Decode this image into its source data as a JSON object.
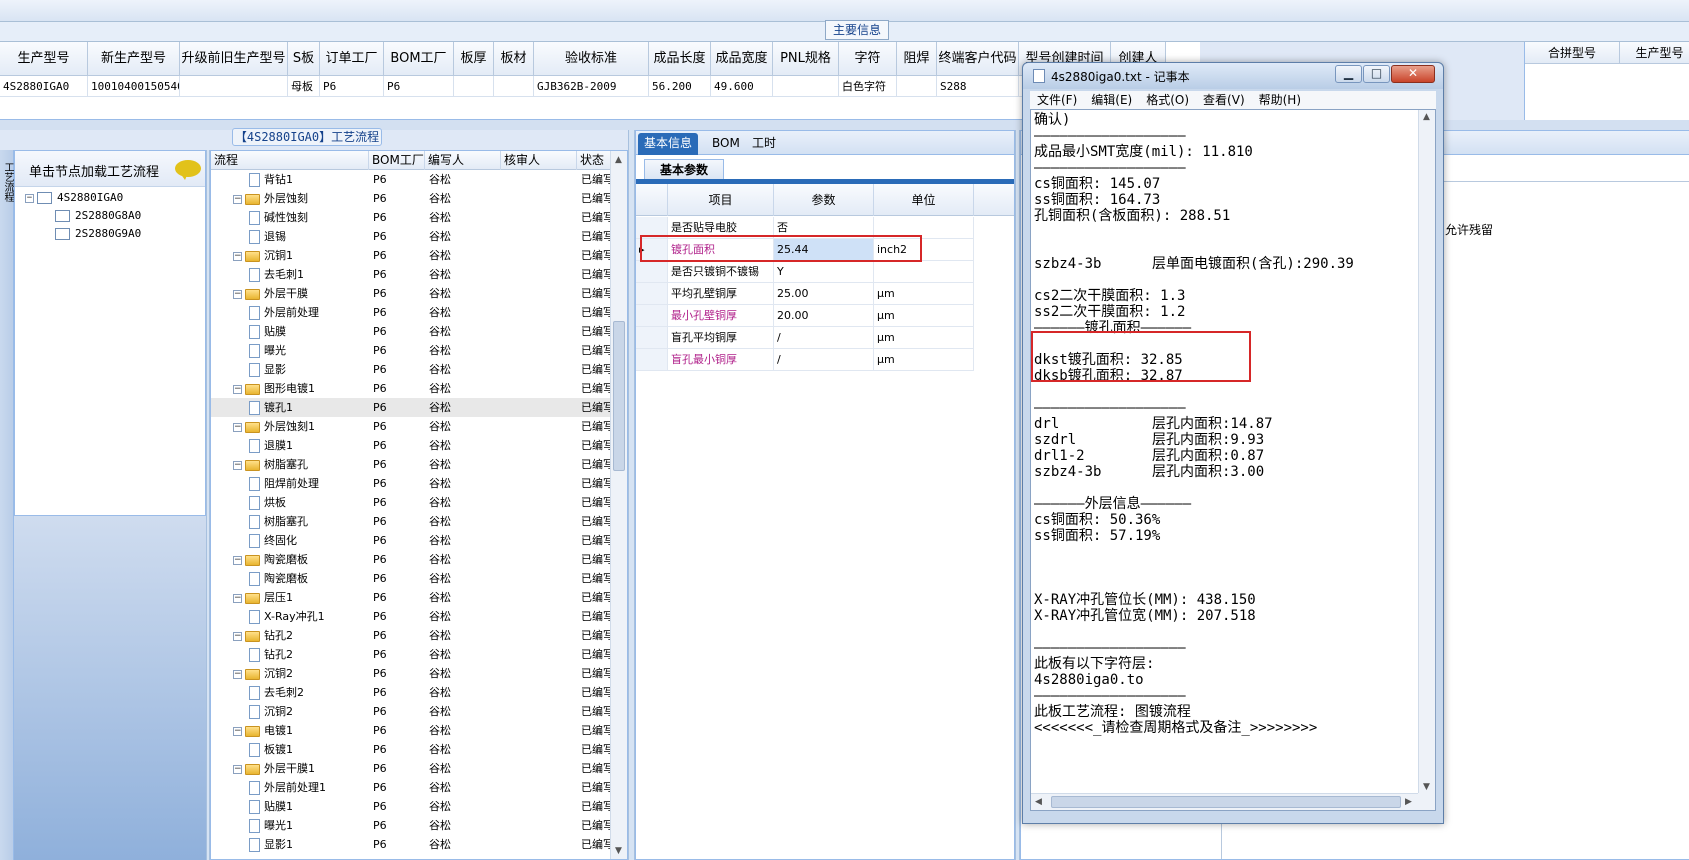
{
  "main_header": {
    "title": "主要信息",
    "columns": [
      "生产型号",
      "新生产型号",
      "升级前旧生产型号",
      "S板",
      "订单工厂",
      "BOM工厂",
      "板厚",
      "板材",
      "验收标准",
      "成品长度",
      "成品宽度",
      "PNL规格",
      "字符",
      "阻焊",
      "终端客户代码",
      "型号创建时间",
      "创建人"
    ],
    "row": [
      "4S2880IGA0",
      "10010400150540",
      "",
      "母板",
      "P6",
      "P6",
      "",
      "",
      "GJB362B-2009",
      "56.200",
      "49.600",
      "",
      "白色字符",
      "",
      "S288",
      "",
      ""
    ],
    "right_columns": [
      "合拼型号",
      "生产型号"
    ]
  },
  "left_panel": {
    "tab_label": "工艺流程",
    "header": "单击节点加载工艺流程",
    "tree": [
      "4S2880IGA0",
      "2S2880G8A0",
      "2S2880G9A0"
    ]
  },
  "flow_panel": {
    "title": "【4S2880IGA0】工艺流程",
    "columns": [
      "流程",
      "BOM工厂",
      "编写人",
      "核审人",
      "状态"
    ],
    "rows": [
      {
        "name": "背钻1",
        "level": 2,
        "folder": false,
        "bom": "P6",
        "author": "谷松",
        "reviewer": "",
        "status": "已编写"
      },
      {
        "name": "外层蚀刻",
        "level": 1,
        "folder": true,
        "bom": "P6",
        "author": "谷松",
        "reviewer": "",
        "status": "已编写"
      },
      {
        "name": "碱性蚀刻",
        "level": 2,
        "folder": false,
        "bom": "P6",
        "author": "谷松",
        "reviewer": "",
        "status": "已编写"
      },
      {
        "name": "退锡",
        "level": 2,
        "folder": false,
        "bom": "P6",
        "author": "谷松",
        "reviewer": "",
        "status": "已编写"
      },
      {
        "name": "沉铜1",
        "level": 1,
        "folder": true,
        "bom": "P6",
        "author": "谷松",
        "reviewer": "",
        "status": "已编写"
      },
      {
        "name": "去毛刺1",
        "level": 2,
        "folder": false,
        "bom": "P6",
        "author": "谷松",
        "reviewer": "",
        "status": "已编写"
      },
      {
        "name": "外层干膜",
        "level": 1,
        "folder": true,
        "bom": "P6",
        "author": "谷松",
        "reviewer": "",
        "status": "已编写"
      },
      {
        "name": "外层前处理",
        "level": 2,
        "folder": false,
        "bom": "P6",
        "author": "谷松",
        "reviewer": "",
        "status": "已编写"
      },
      {
        "name": "贴膜",
        "level": 2,
        "folder": false,
        "bom": "P6",
        "author": "谷松",
        "reviewer": "",
        "status": "已编写"
      },
      {
        "name": "曝光",
        "level": 2,
        "folder": false,
        "bom": "P6",
        "author": "谷松",
        "reviewer": "",
        "status": "已编写"
      },
      {
        "name": "显影",
        "level": 2,
        "folder": false,
        "bom": "P6",
        "author": "谷松",
        "reviewer": "",
        "status": "已编写"
      },
      {
        "name": "图形电镀1",
        "level": 1,
        "folder": true,
        "bom": "P6",
        "author": "谷松",
        "reviewer": "",
        "status": "已编写"
      },
      {
        "name": "镀孔1",
        "level": 2,
        "folder": false,
        "bom": "P6",
        "author": "谷松",
        "reviewer": "",
        "status": "已编写",
        "selected": true
      },
      {
        "name": "外层蚀刻1",
        "level": 1,
        "folder": true,
        "bom": "P6",
        "author": "谷松",
        "reviewer": "",
        "status": "已编写"
      },
      {
        "name": "退膜1",
        "level": 2,
        "folder": false,
        "bom": "P6",
        "author": "谷松",
        "reviewer": "",
        "status": "已编写"
      },
      {
        "name": "树脂塞孔",
        "level": 1,
        "folder": true,
        "bom": "P6",
        "author": "谷松",
        "reviewer": "",
        "status": "已编写"
      },
      {
        "name": "阻焊前处理",
        "level": 2,
        "folder": false,
        "bom": "P6",
        "author": "谷松",
        "reviewer": "",
        "status": "已编写"
      },
      {
        "name": "烘板",
        "level": 2,
        "folder": false,
        "bom": "P6",
        "author": "谷松",
        "reviewer": "",
        "status": "已编写"
      },
      {
        "name": "树脂塞孔",
        "level": 2,
        "folder": false,
        "bom": "P6",
        "author": "谷松",
        "reviewer": "",
        "status": "已编写"
      },
      {
        "name": "终固化",
        "level": 2,
        "folder": false,
        "bom": "P6",
        "author": "谷松",
        "reviewer": "",
        "status": "已编写"
      },
      {
        "name": "陶瓷磨板",
        "level": 1,
        "folder": true,
        "bom": "P6",
        "author": "谷松",
        "reviewer": "",
        "status": "已编写"
      },
      {
        "name": "陶瓷磨板",
        "level": 2,
        "folder": false,
        "bom": "P6",
        "author": "谷松",
        "reviewer": "",
        "status": "已编写"
      },
      {
        "name": "层压1",
        "level": 1,
        "folder": true,
        "bom": "P6",
        "author": "谷松",
        "reviewer": "",
        "status": "已编写"
      },
      {
        "name": "X-Ray冲孔1",
        "level": 2,
        "folder": false,
        "bom": "P6",
        "author": "谷松",
        "reviewer": "",
        "status": "已编写"
      },
      {
        "name": "钻孔2",
        "level": 1,
        "folder": true,
        "bom": "P6",
        "author": "谷松",
        "reviewer": "",
        "status": "已编写"
      },
      {
        "name": "钻孔2",
        "level": 2,
        "folder": false,
        "bom": "P6",
        "author": "谷松",
        "reviewer": "",
        "status": "已编写"
      },
      {
        "name": "沉铜2",
        "level": 1,
        "folder": true,
        "bom": "P6",
        "author": "谷松",
        "reviewer": "",
        "status": "已编写"
      },
      {
        "name": "去毛刺2",
        "level": 2,
        "folder": false,
        "bom": "P6",
        "author": "谷松",
        "reviewer": "",
        "status": "已编写"
      },
      {
        "name": "沉铜2",
        "level": 2,
        "folder": false,
        "bom": "P6",
        "author": "谷松",
        "reviewer": "",
        "status": "已编写"
      },
      {
        "name": "电镀1",
        "level": 1,
        "folder": true,
        "bom": "P6",
        "author": "谷松",
        "reviewer": "",
        "status": "已编写"
      },
      {
        "name": "板镀1",
        "level": 2,
        "folder": false,
        "bom": "P6",
        "author": "谷松",
        "reviewer": "",
        "status": "已编写"
      },
      {
        "name": "外层干膜1",
        "level": 1,
        "folder": true,
        "bom": "P6",
        "author": "谷松",
        "reviewer": "",
        "status": "已编写"
      },
      {
        "name": "外层前处理1",
        "level": 2,
        "folder": false,
        "bom": "P6",
        "author": "谷松",
        "reviewer": "",
        "status": "已编写"
      },
      {
        "name": "贴膜1",
        "level": 2,
        "folder": false,
        "bom": "P6",
        "author": "谷松",
        "reviewer": "",
        "status": "已编写"
      },
      {
        "name": "曝光1",
        "level": 2,
        "folder": false,
        "bom": "P6",
        "author": "谷松",
        "reviewer": "",
        "status": "已编写"
      },
      {
        "name": "显影1",
        "level": 2,
        "folder": false,
        "bom": "P6",
        "author": "谷松",
        "reviewer": "",
        "status": "已编写"
      }
    ]
  },
  "detail": {
    "tabs": [
      "基本信息",
      "BOM",
      "工时"
    ],
    "subtab": "基本参数",
    "columns": [
      "项目",
      "参数",
      "单位"
    ],
    "params": [
      {
        "item": "是否贴导电胶",
        "value": "否",
        "unit": "",
        "highlight": false
      },
      {
        "item": "镀孔面积",
        "value": "25.44",
        "unit": "inch2",
        "highlight": true,
        "selected": true
      },
      {
        "item": "是否只镀铜不镀锡",
        "value": "Y",
        "unit": "",
        "highlight": false
      },
      {
        "item": "平均孔壁铜厚",
        "value": "25.00",
        "unit": "μm",
        "highlight": false
      },
      {
        "item": "最小孔壁铜厚",
        "value": "20.00",
        "unit": "μm",
        "highlight": true
      },
      {
        "item": "盲孔平均铜厚",
        "value": "/",
        "unit": "μm",
        "highlight": false
      },
      {
        "item": "盲孔最小铜厚",
        "value": "/",
        "unit": "μm",
        "highlight": true
      }
    ]
  },
  "right_area": {
    "snippet": "允许残留"
  },
  "notepad": {
    "title": "4s2880iga0.txt - 记事本",
    "minimize": "▁",
    "maximize": "□",
    "close": "✕",
    "menu": [
      "文件(F)",
      "编辑(E)",
      "格式(O)",
      "查看(V)",
      "帮助(H)"
    ],
    "lines": [
      "确认)",
      "——————————————————",
      "成品最小SMT宽度(mil): 11.810",
      "——————————————————",
      "cs铜面积: 145.07",
      "ss铜面积: 164.73",
      "孔铜面积(含板面积): 288.51",
      "",
      "",
      "szbz4-3b      层单面电镀面积(含孔):290.39",
      "",
      "cs2二次干膜面积: 1.3",
      "ss2二次干膜面积: 1.2",
      "——————镀孔面积——————",
      "",
      "dkst镀孔面积: 32.85",
      "dksb镀孔面积: 32.87",
      "",
      "——————————————————",
      "drl           层孔内面积:14.87",
      "szdrl         层孔内面积:9.93",
      "drl1-2        层孔内面积:0.87",
      "szbz4-3b      层孔内面积:3.00",
      "",
      "——————外层信息——————",
      "cs铜面积: 50.36%",
      "ss铜面积: 57.19%",
      "",
      "",
      "",
      "X-RAY冲孔管位长(MM): 438.150",
      "X-RAY冲孔管位宽(MM): 207.518",
      "",
      "——————————————————",
      "此板有以下字符层:",
      "4s2880iga0.to",
      "——————————————————",
      "此板工艺流程: 图镀流程",
      "<<<<<<<_请检查周期格式及备注_>>>>>>>>"
    ]
  }
}
